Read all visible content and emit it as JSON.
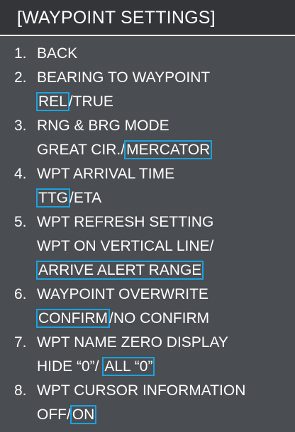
{
  "menu": {
    "title": "[WAYPOINT SETTINGS]",
    "items": [
      {
        "number": "1.",
        "label": "BACK"
      },
      {
        "number": "2.",
        "label": "BEARING TO WAYPOINT",
        "options": [
          "REL",
          "TRUE"
        ],
        "selected": "REL"
      },
      {
        "number": "3.",
        "label": "RNG & BRG MODE",
        "options": [
          "GREAT CIR.",
          "MERCATOR"
        ],
        "selected": "MERCATOR"
      },
      {
        "number": "4.",
        "label": "WPT ARRIVAL TIME",
        "options": [
          "TTG",
          "ETA"
        ],
        "selected": "TTG"
      },
      {
        "number": "5.",
        "label": "WPT REFRESH SETTING",
        "options": [
          "WPT ON VERTICAL LINE",
          "ARRIVE ALERT RANGE"
        ],
        "selected": "ARRIVE ALERT RANGE"
      },
      {
        "number": "6.",
        "label": "WAYPOINT OVERWRITE",
        "options": [
          "CONFIRM",
          "NO CONFIRM"
        ],
        "selected": "CONFIRM"
      },
      {
        "number": "7.",
        "label": "WPT NAME ZERO DISPLAY",
        "options": [
          "HIDE “0”",
          "ALL “0”"
        ],
        "selected": "ALL “0”"
      },
      {
        "number": "8.",
        "label": "WPT CURSOR INFORMATION",
        "options": [
          "OFF",
          "ON"
        ],
        "selected": "ON"
      }
    ]
  },
  "colors": {
    "panel": "#4a4d51",
    "titlebar": "#333538",
    "text": "#ffffff",
    "selection_border": "#1aa3e0"
  }
}
